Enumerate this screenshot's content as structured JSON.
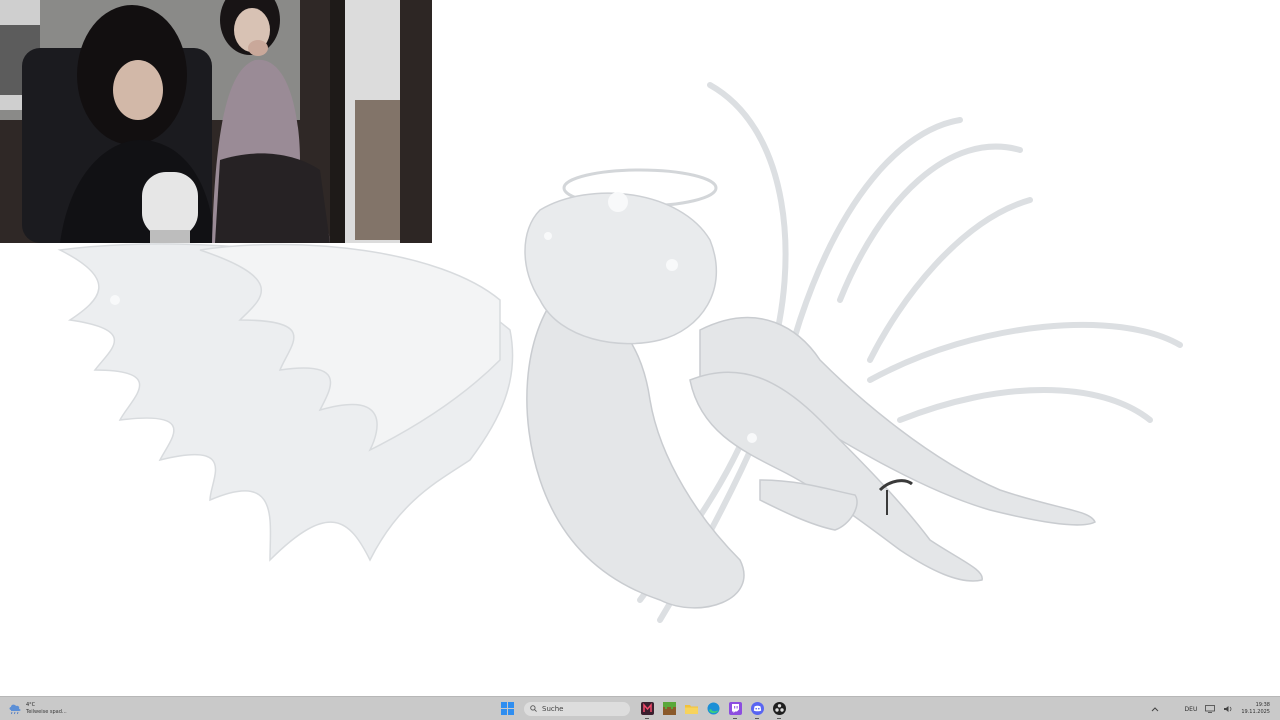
{
  "weather": {
    "icon": "cloud-rain-icon",
    "temp": "4°C",
    "desc": "Teilweise spad..."
  },
  "search": {
    "placeholder": "Suche",
    "icon": "search-icon"
  },
  "taskbar_apps": [
    {
      "name": "start-button",
      "icon": "windows-icon"
    },
    {
      "name": "app-wallpaper",
      "icon": "wallpaper-app-icon"
    },
    {
      "name": "app-minecraft",
      "icon": "grass-block-icon"
    },
    {
      "name": "app-explorer",
      "icon": "folder-icon"
    },
    {
      "name": "app-edge",
      "icon": "edge-icon"
    },
    {
      "name": "app-twitch",
      "icon": "twitch-icon"
    },
    {
      "name": "app-discord",
      "icon": "discord-icon"
    },
    {
      "name": "app-obs",
      "icon": "obs-icon"
    }
  ],
  "tray": {
    "language": "DEU",
    "time": "19:38",
    "date": "19.11.2025"
  },
  "colors": {
    "taskbar": "#c9c9c9",
    "desktop": "#ffffff"
  }
}
